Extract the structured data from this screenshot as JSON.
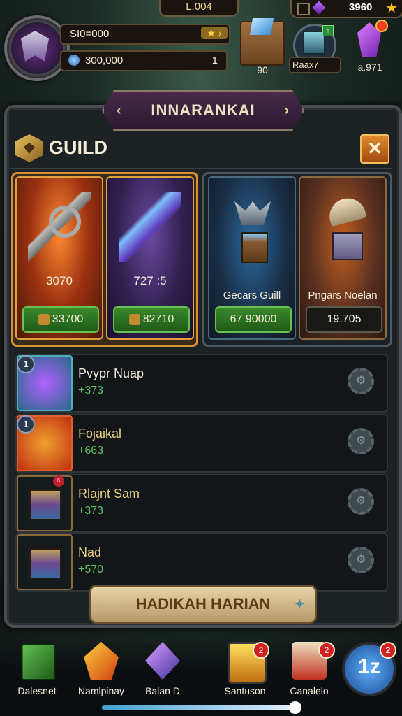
{
  "hud": {
    "level": "L.004",
    "gems": "3960"
  },
  "player": {
    "gold": "SI0=000",
    "coins": "300,000",
    "coins_count": "1"
  },
  "top_items": [
    {
      "label": "90"
    },
    {
      "label": "Raax7"
    },
    {
      "label": "a.971"
    }
  ],
  "banner": {
    "title": "INNARANKAI"
  },
  "guild": {
    "title": "GUILD",
    "close": "✕"
  },
  "cards": [
    {
      "value": "3070",
      "name": "",
      "price": "33700",
      "price_style": "green"
    },
    {
      "value": "727 :5",
      "name": "",
      "price": "82710",
      "price_style": "green"
    },
    {
      "value": "",
      "name": "Gecars Guill",
      "price": "67 90000",
      "price_style": "green"
    },
    {
      "value": "",
      "name": "Pngars Noelan",
      "price": "19.705",
      "price_style": "dark"
    }
  ],
  "list": [
    {
      "badge": "1",
      "name": "Pvypr Nuap",
      "value": "+373"
    },
    {
      "badge": "1",
      "name": "Fojaikal",
      "value": "+663"
    },
    {
      "badge": "",
      "name": "Rlajnt Sam",
      "value": "+373"
    },
    {
      "badge": "",
      "name": "Nad",
      "value": "+570"
    }
  ],
  "harian_button": "HADIKAH HARIAN",
  "bottom_nav": [
    {
      "label": "Dalesnet",
      "badge": ""
    },
    {
      "label": "Namlpinay",
      "badge": ""
    },
    {
      "label": "Balan D",
      "badge": ""
    },
    {
      "label": "Santuson",
      "badge": "2"
    },
    {
      "label": "Canalelo",
      "badge": "2"
    }
  ],
  "level_button": {
    "text": "1z",
    "badge": "2"
  },
  "colors": {
    "accent": "#d89030",
    "green": "#3a8a2a",
    "panel": "#1c2224"
  }
}
